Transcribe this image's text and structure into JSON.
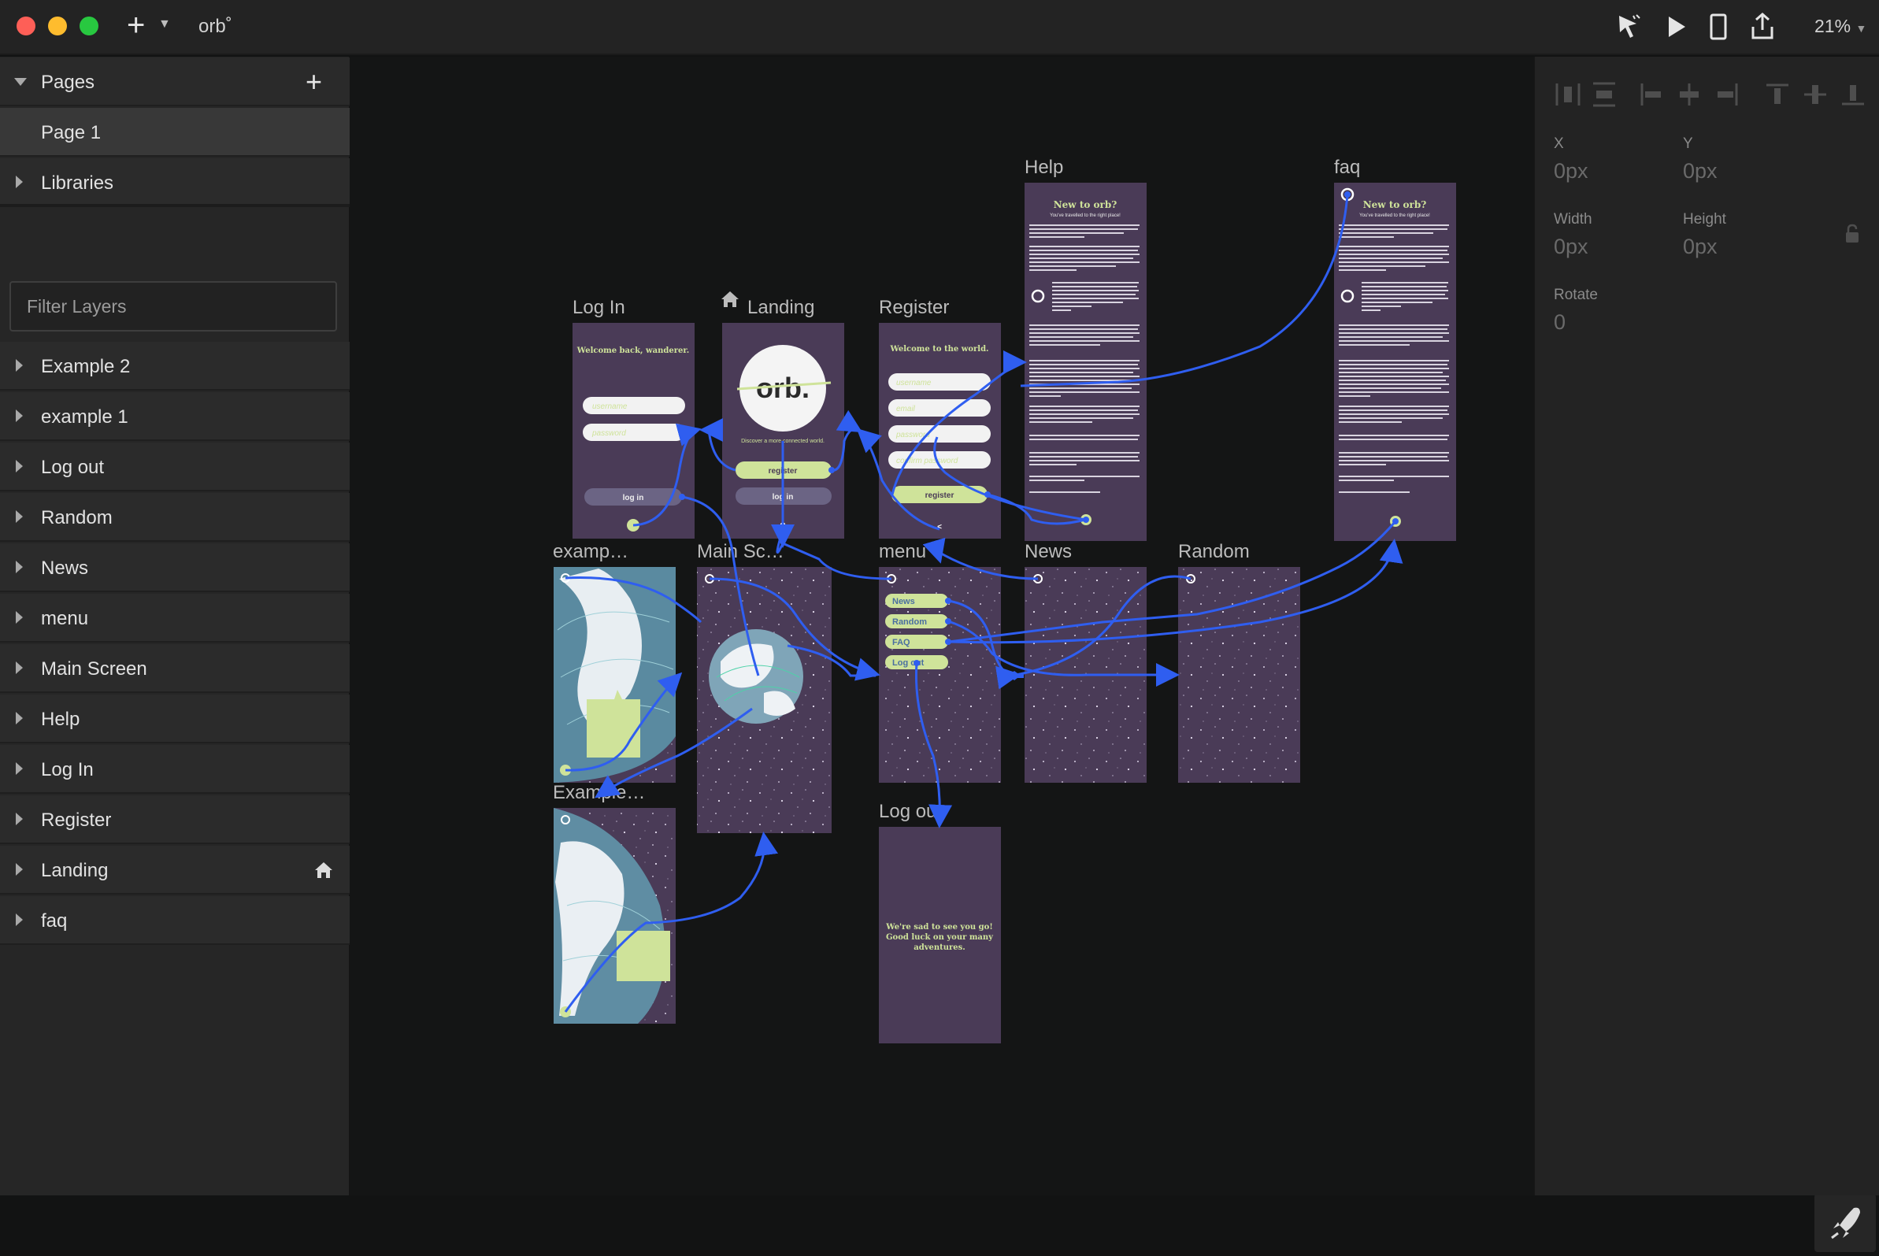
{
  "titlebar": {
    "doc_title": "orb˚",
    "zoom": "21%",
    "icons": [
      "add-icon",
      "preview-pointer-icon",
      "play-icon",
      "device-icon",
      "export-icon"
    ]
  },
  "sidebar": {
    "pages_header": "Pages",
    "pages": [
      "Page 1"
    ],
    "libraries": "Libraries",
    "filter_placeholder": "Filter Layers",
    "layers": [
      "Example 2",
      "example 1",
      "Log out",
      "Random",
      "News",
      "menu",
      "Main Screen",
      "Help",
      "Log In",
      "Register",
      "Landing",
      "faq"
    ]
  },
  "inspector": {
    "x_label": "X",
    "x_value": "0px",
    "y_label": "Y",
    "y_value": "0px",
    "w_label": "Width",
    "w_value": "0px",
    "h_label": "Height",
    "h_value": "0px",
    "r_label": "Rotate",
    "r_value": "0"
  },
  "frames": {
    "login": {
      "label": "Log In",
      "heading": "Welcome back, wanderer.",
      "username_ph": "username",
      "password_ph": "password",
      "button": "log in"
    },
    "landing": {
      "label": "Landing",
      "logo": "orb.",
      "tagline": "Discover a more connected world.",
      "register_btn": "register",
      "login_btn": "log in",
      "help": "?"
    },
    "register": {
      "label": "Register",
      "heading": "Welcome to the world.",
      "fields": [
        "username",
        "email",
        "password",
        "confirm password"
      ],
      "button": "register"
    },
    "help": {
      "label": "Help",
      "heading": "New to orb?",
      "sub": "You've travelled to the right place!"
    },
    "faq": {
      "label": "faq",
      "heading": "New to orb?",
      "sub": "You've travelled to the right place!"
    },
    "example1": {
      "label": "examp…"
    },
    "main": {
      "label": "Main Sc…"
    },
    "menu": {
      "label": "menu",
      "items": [
        "News",
        "Random",
        "FAQ",
        "Log out"
      ]
    },
    "news": {
      "label": "News"
    },
    "random": {
      "label": "Random"
    },
    "example2": {
      "label": "Example…"
    },
    "logout": {
      "label": "Log out",
      "message": [
        "We're sad to see you go!",
        "Good luck on your many",
        "adventures."
      ]
    }
  },
  "colors": {
    "frame_purple": "#4a3b57",
    "accent_green": "#cfe39a",
    "link_blue": "#2f5ef0"
  }
}
